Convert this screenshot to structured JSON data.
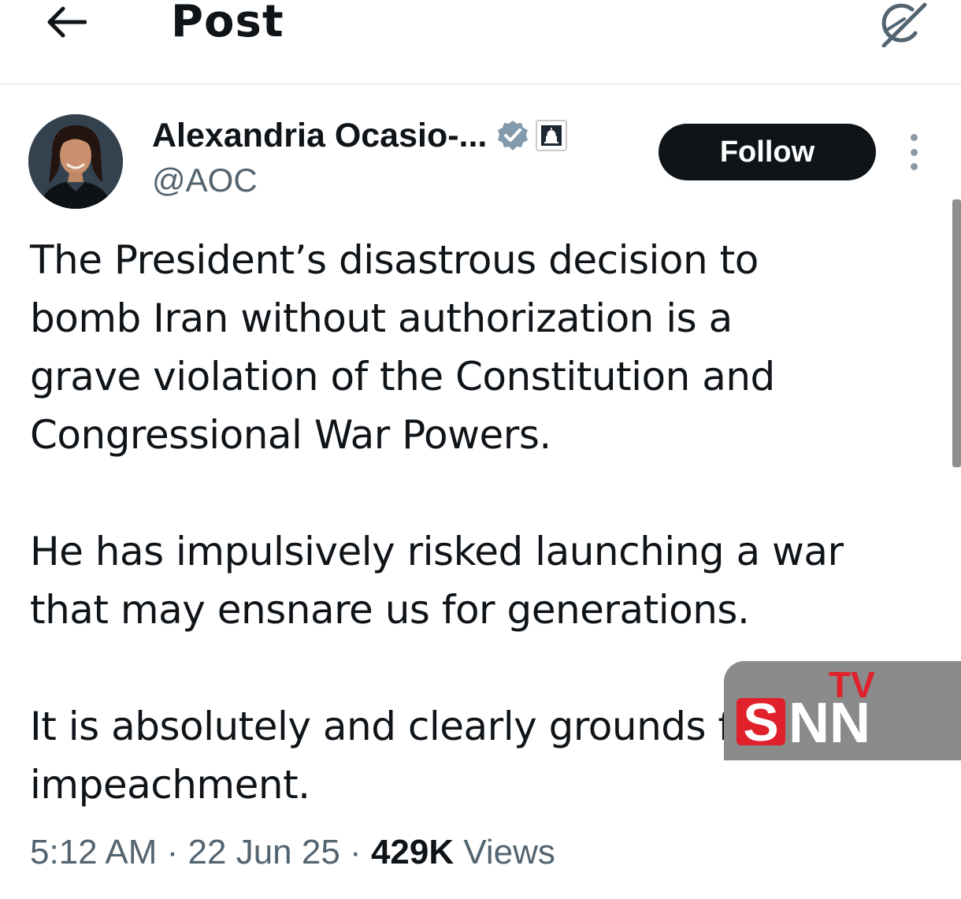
{
  "header": {
    "title": "Post",
    "back_icon": "arrow-left-icon",
    "grok_icon": "grok-icon"
  },
  "author": {
    "name": "Alexandria Ocasio-...",
    "handle": "@AOC",
    "verified_icon": "verified-badge-icon",
    "affiliation_icon": "capitol-dome-icon",
    "verified_color": "#829aab"
  },
  "follow_label": "Follow",
  "more_icon": "more-vertical-icon",
  "tweet": {
    "paragraphs": [
      "The President’s disastrous decision to\nbomb Iran without authorization is a\ngrave violation of the Constitution and\nCongressional War Powers.",
      "He has impulsively risked launching a war\nthat may ensnare us for generations.",
      "It is absolutely and clearly grounds for\nimpeachment."
    ]
  },
  "meta": {
    "time": "5:12 AM",
    "separator1": " · ",
    "date": "22 Jun 25",
    "separator2": " · ",
    "views_count": "429K",
    "views_label": " Views"
  },
  "watermark": {
    "s": "S",
    "nn": "NN",
    "tv": "TV",
    "red": "#e0202a"
  }
}
